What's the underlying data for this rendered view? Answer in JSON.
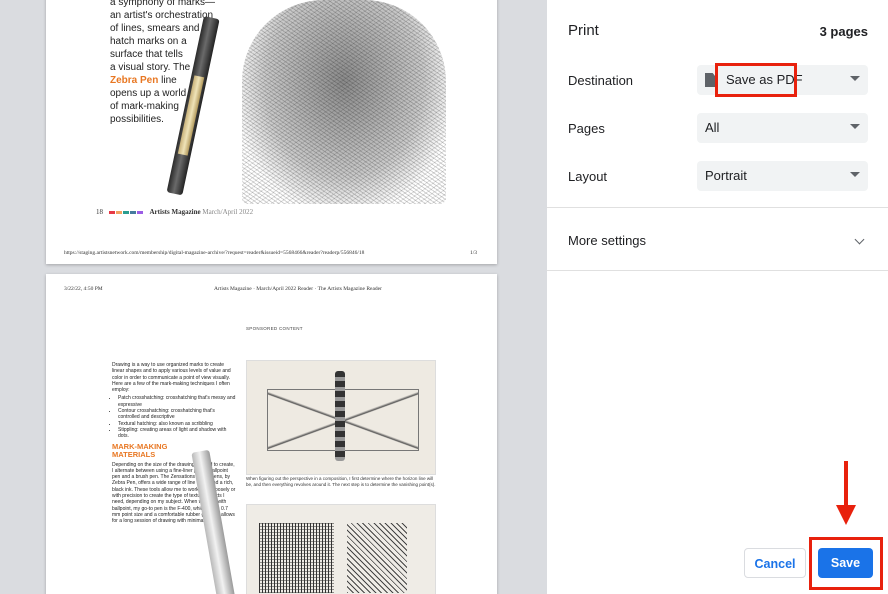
{
  "preview": {
    "page1": {
      "intro_lines": "a symphony of marks—\nan artist's orchestration\nof lines, smears and\nhatch marks on a\nsurface that tells\na visual story. The",
      "highlight": "Zebra Pen",
      "intro_tail": " line\nopens up a world\nof mark-making\npossibilities.",
      "folio_num": "18",
      "folio_mag": "Artists Magazine",
      "folio_issue": "March/April 2022",
      "folio_colors": [
        "#e63946",
        "#f4a261",
        "#2a9d8f",
        "#457b9d",
        "#9b5de5"
      ],
      "footer_url": "https://staging.artistsnetwork.com/membership/digital-magazine-archive/?request=reader&issueid=5568466&reader?readerp/556846/18",
      "page_num": "1/3"
    },
    "page2": {
      "header_date": "3/22/22, 4:50 PM",
      "header_title": "Artists Magazine · March/April 2022 Reader · The Artists Magazine Reader",
      "sponsored": "SPONSORED CONTENT",
      "body_intro": "Drawing is a way to use organized marks to create linear shapes and to apply various levels of value and color in order to communicate a point of view visually. Here are a few of the mark-making techniques I often employ:",
      "bullets": [
        "Patch crosshatching: crosshatching that's messy and expressive",
        "Contour crosshatching: crosshatching that's controlled and descriptive",
        "Textural hatching: also known as scribbling",
        "Stippling: creating areas of light and shadow with dots."
      ],
      "heading": "MARK-MAKING\nMATERIALS",
      "body_2": "Depending on the size of the drawing I intend to create, I alternate between using a fine-liner pen, a ballpoint pen and a brush pen. The Zensations line of pens, by Zebra Pen, offers a wide range of line types and a rich, black ink. These tools allow me to work either loosely or with precision to create the type of textural effects I need, depending on my subject. When working with ballpoint, my go-to pen is the F-400, which has a 0.7 mm point size and a comfortable rubber grip that allows for a long session of drawing with minimal strain.",
      "caption": "When figuring out the perspective in a composition, I first determine where the horizon line will be, and then everything revolves around it. The next step is to determine the vanishing point(s)."
    }
  },
  "settings": {
    "title": "Print",
    "page_count": "3 pages",
    "destination_label": "Destination",
    "destination_value": "Save as PDF",
    "pages_label": "Pages",
    "pages_value": "All",
    "layout_label": "Layout",
    "layout_value": "Portrait",
    "more_settings": "More settings",
    "cancel": "Cancel",
    "save": "Save"
  },
  "colors": {
    "accent": "#1a73e8",
    "annotation": "#e8210d",
    "highlight_text": "#e87722"
  }
}
